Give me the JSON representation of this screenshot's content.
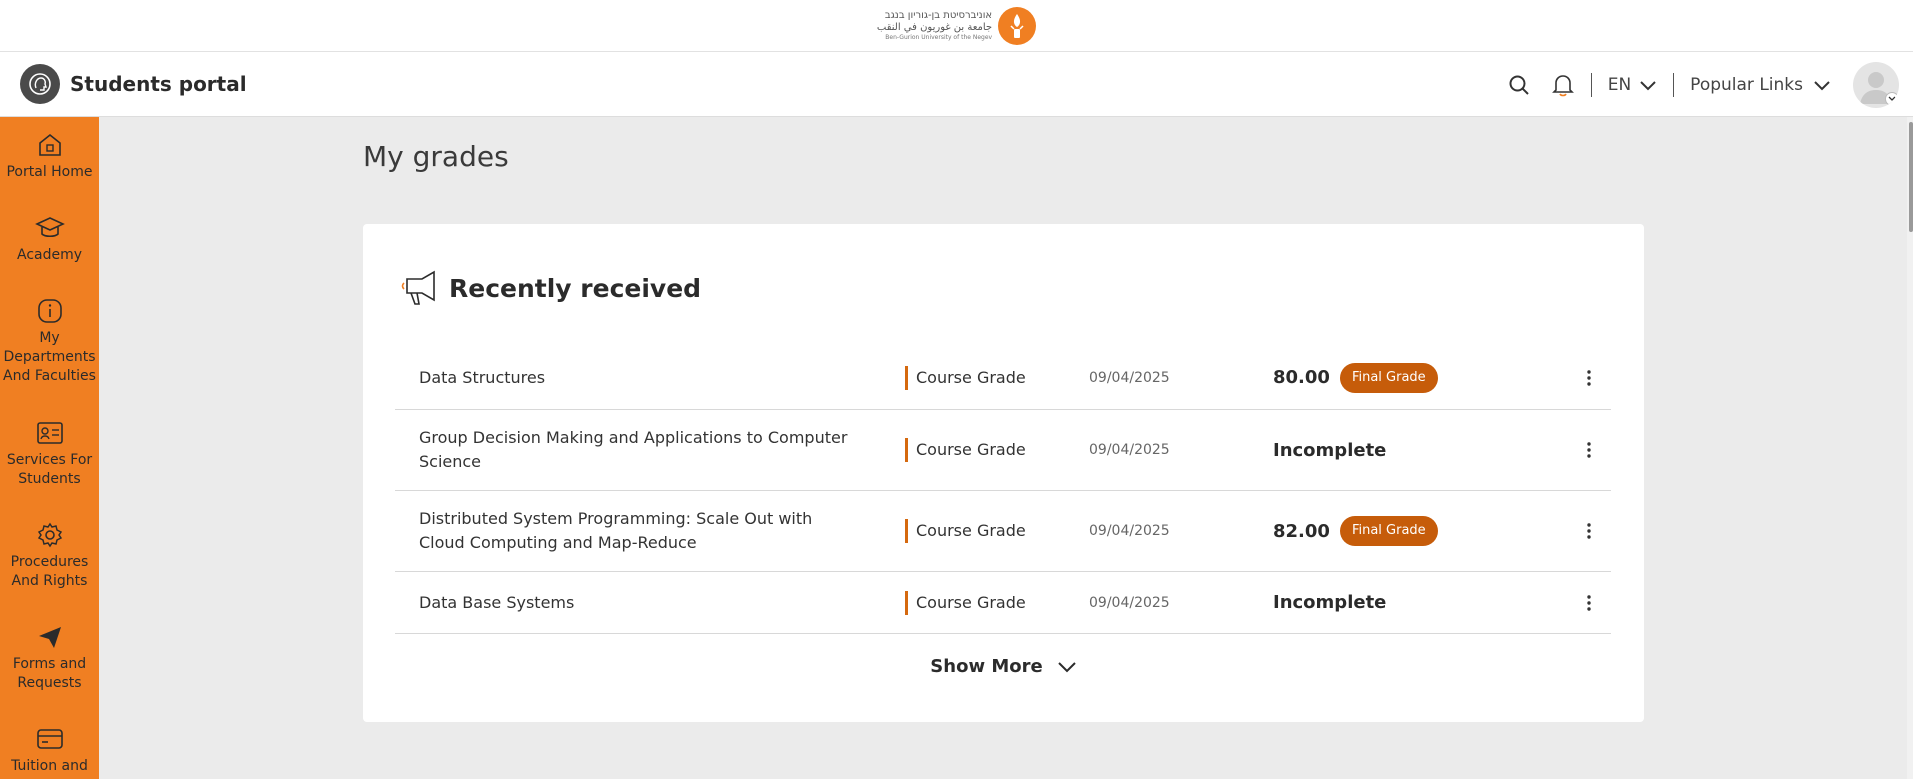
{
  "university_logo": {
    "hebrew": "אוניברסיטת בן-גוריון בנגב",
    "arabic": "جامعة بن غوريون في النقب",
    "english": "Ben-Gurion University of the Negev"
  },
  "header": {
    "title": "Students portal",
    "language": "EN",
    "popular_links": "Popular Links"
  },
  "sidebar": {
    "items": [
      {
        "label": "Portal Home",
        "icon": "home-icon"
      },
      {
        "label": "Academy",
        "icon": "graduation-cap-icon"
      },
      {
        "label": "My Departments And Faculties",
        "icon": "info-icon"
      },
      {
        "label": "Services For Students",
        "icon": "id-card-icon"
      },
      {
        "label": "Procedures And Rights",
        "icon": "gear-icon"
      },
      {
        "label": "Forms and Requests",
        "icon": "paper-plane-icon"
      },
      {
        "label": "Tuition and",
        "icon": "credit-card-icon"
      }
    ]
  },
  "main": {
    "page_title": "My grades",
    "card_title": "Recently received",
    "show_more": "Show More",
    "grades": [
      {
        "course": "Data Structures",
        "type": "Course Grade",
        "date": "09/04/2025",
        "grade": "80.00",
        "badge": "Final Grade"
      },
      {
        "course": "Group Decision Making and Applications to Computer Science",
        "type": "Course Grade",
        "date": "09/04/2025",
        "grade": "Incomplete",
        "badge": ""
      },
      {
        "course": "Distributed System Programming: Scale Out with Cloud Computing and Map-Reduce",
        "type": "Course Grade",
        "date": "09/04/2025",
        "grade": "82.00",
        "badge": "Final Grade"
      },
      {
        "course": "Data Base Systems",
        "type": "Course Grade",
        "date": "09/04/2025",
        "grade": "Incomplete",
        "badge": ""
      }
    ]
  },
  "colors": {
    "accent": "#f07f22",
    "badge": "#c65c0a",
    "divider": "#d5690f"
  }
}
